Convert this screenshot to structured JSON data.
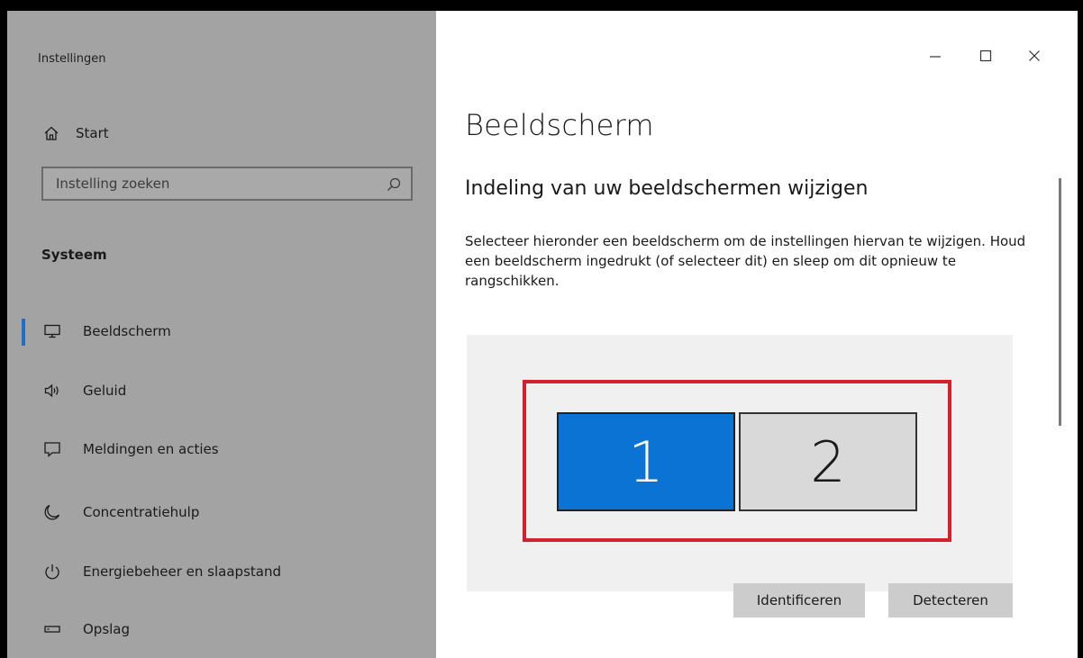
{
  "window": {
    "app_title": "Instellingen",
    "controls": {
      "minimize": "—",
      "maximize": "☐",
      "close": "✕"
    }
  },
  "sidebar": {
    "home_label": "Start",
    "home_icon": "home-icon",
    "search": {
      "placeholder": "Instelling zoeken",
      "value": "",
      "icon": "search-icon"
    },
    "section_heading": "Systeem",
    "items": [
      {
        "label": "Beeldscherm",
        "icon": "monitor-icon",
        "active": true
      },
      {
        "label": "Geluid",
        "icon": "speaker-icon",
        "active": false
      },
      {
        "label": "Meldingen en acties",
        "icon": "notification-icon",
        "active": false
      },
      {
        "label": "Concentratiehulp",
        "icon": "moon-icon",
        "active": false
      },
      {
        "label": "Energiebeheer en slaapstand",
        "icon": "power-icon",
        "active": false
      },
      {
        "label": "Opslag",
        "icon": "storage-icon",
        "active": false
      }
    ],
    "accent_color": "#1f6fc5"
  },
  "main": {
    "title": "Beeldscherm",
    "subtitle": "Indeling van uw beeldschermen wijzigen",
    "description": "Selecteer hieronder een beeldscherm om de instellingen hiervan te wijzigen. Houd een beeldscherm ingedrukt (of selecteer dit) en sleep om dit opnieuw te rangschikken.",
    "monitors": [
      {
        "number": "1",
        "selected": true
      },
      {
        "number": "2",
        "selected": false
      }
    ],
    "highlight_color": "#d3202a",
    "selected_monitor_color": "#0b73d3",
    "buttons": {
      "identify": "Identificeren",
      "detect": "Detecteren"
    }
  }
}
